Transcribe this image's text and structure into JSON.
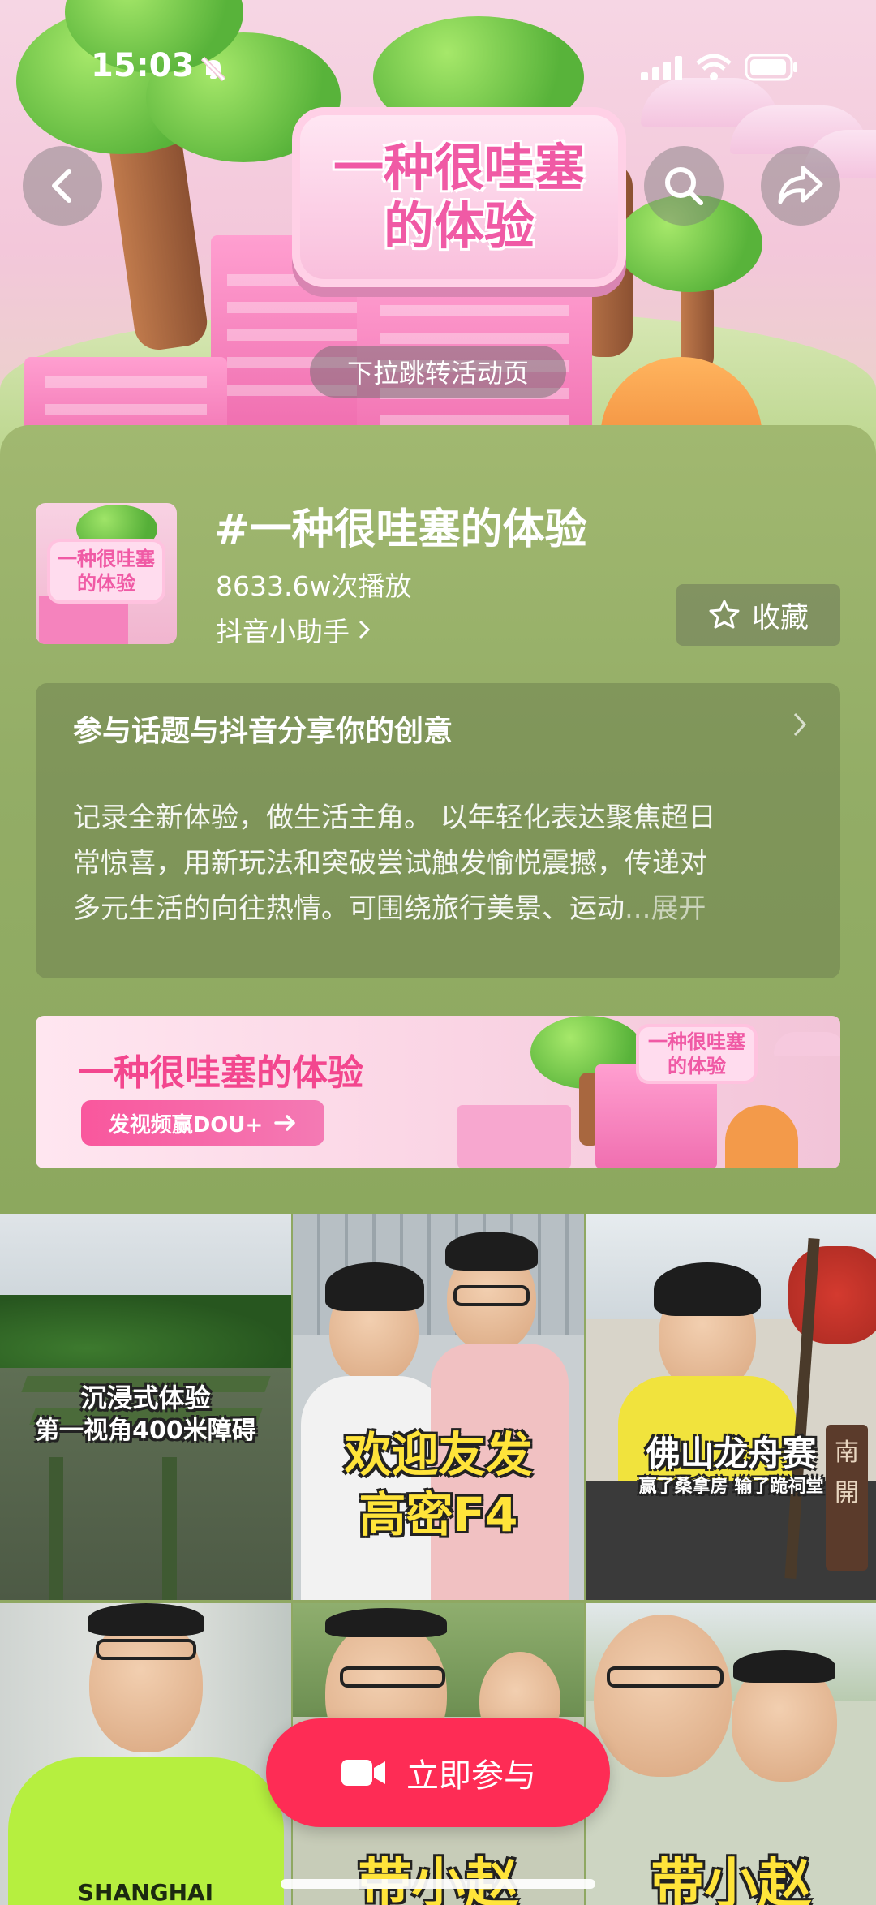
{
  "status_bar": {
    "time": "15:03"
  },
  "banner": {
    "sign_line1": "一种很哇塞",
    "sign_line2": "的体验",
    "pull_hint": "下拉跳转活动页"
  },
  "topic": {
    "thumb_line1": "一种很哇塞",
    "thumb_line2": "的体验",
    "title": "#一种很哇塞的体验",
    "plays": "8633.6w次播放",
    "author": "抖音小助手",
    "favorite_label": "收藏"
  },
  "description": {
    "heading": "参与话题与抖音分享你的创意",
    "line1": "记录全新体验，做生活主角。 以年轻化表达聚焦超日",
    "line2": "常惊喜，用新玩法和突破尝试触发愉悦震撼，传递对",
    "line3": "多元生活的向往热情。可围绕旅行美景、运动",
    "ellipsis": "...",
    "expand": "展开"
  },
  "promo": {
    "title": "一种很哇塞的体验",
    "button": "发视频赢DOU+",
    "art_line1": "一种很哇塞",
    "art_line2": "的体验"
  },
  "videos": [
    {
      "caption1": "沉浸式体验",
      "caption2": "第一视角400米障碍"
    },
    {
      "caption1": "欢迎友发",
      "caption2": "高密F4"
    },
    {
      "caption1": "佛山龙舟赛",
      "caption2": "赢了桑拿房 输了跪祠堂",
      "side_sign": "南開"
    },
    {
      "shirt_text": "SHANGHAI"
    },
    {
      "caption1": "带小赵"
    },
    {
      "caption1": "带小赵"
    }
  ],
  "join_button": {
    "label": "立即参与"
  },
  "colors": {
    "accent": "#fe2c55",
    "panel": "#93ad66",
    "promo_pink": "#f3468e"
  }
}
